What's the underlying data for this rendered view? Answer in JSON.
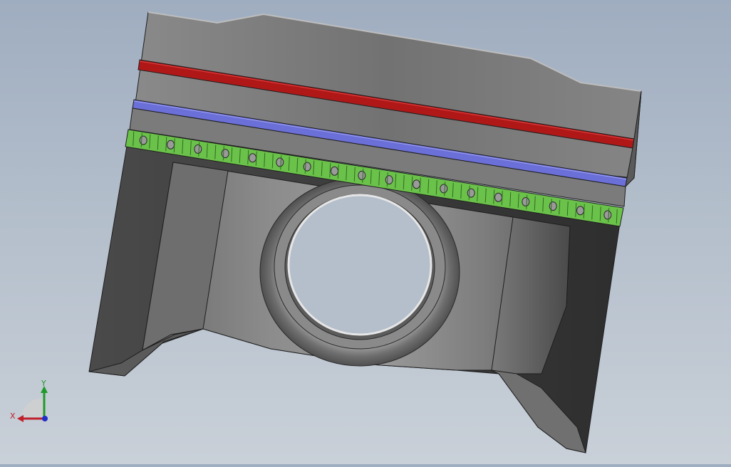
{
  "viewport": {
    "background_top": "#9fadc0",
    "background_bottom": "#c9d0d8"
  },
  "model": {
    "name": "piston",
    "colors": {
      "body_light": "#9b9b9b",
      "body_mid": "#7a7a7a",
      "body_dark": "#3c3c3c",
      "ring_top": "#b01818",
      "ring_second": "#6b6fd8",
      "oil_ring": "#6bc24a",
      "edge": "#1e1e1e"
    }
  },
  "triad": {
    "x_label": "X",
    "y_label": "Y",
    "x_color": "#c0202a",
    "y_color": "#1f9a2a",
    "z_color": "#2030c8"
  }
}
